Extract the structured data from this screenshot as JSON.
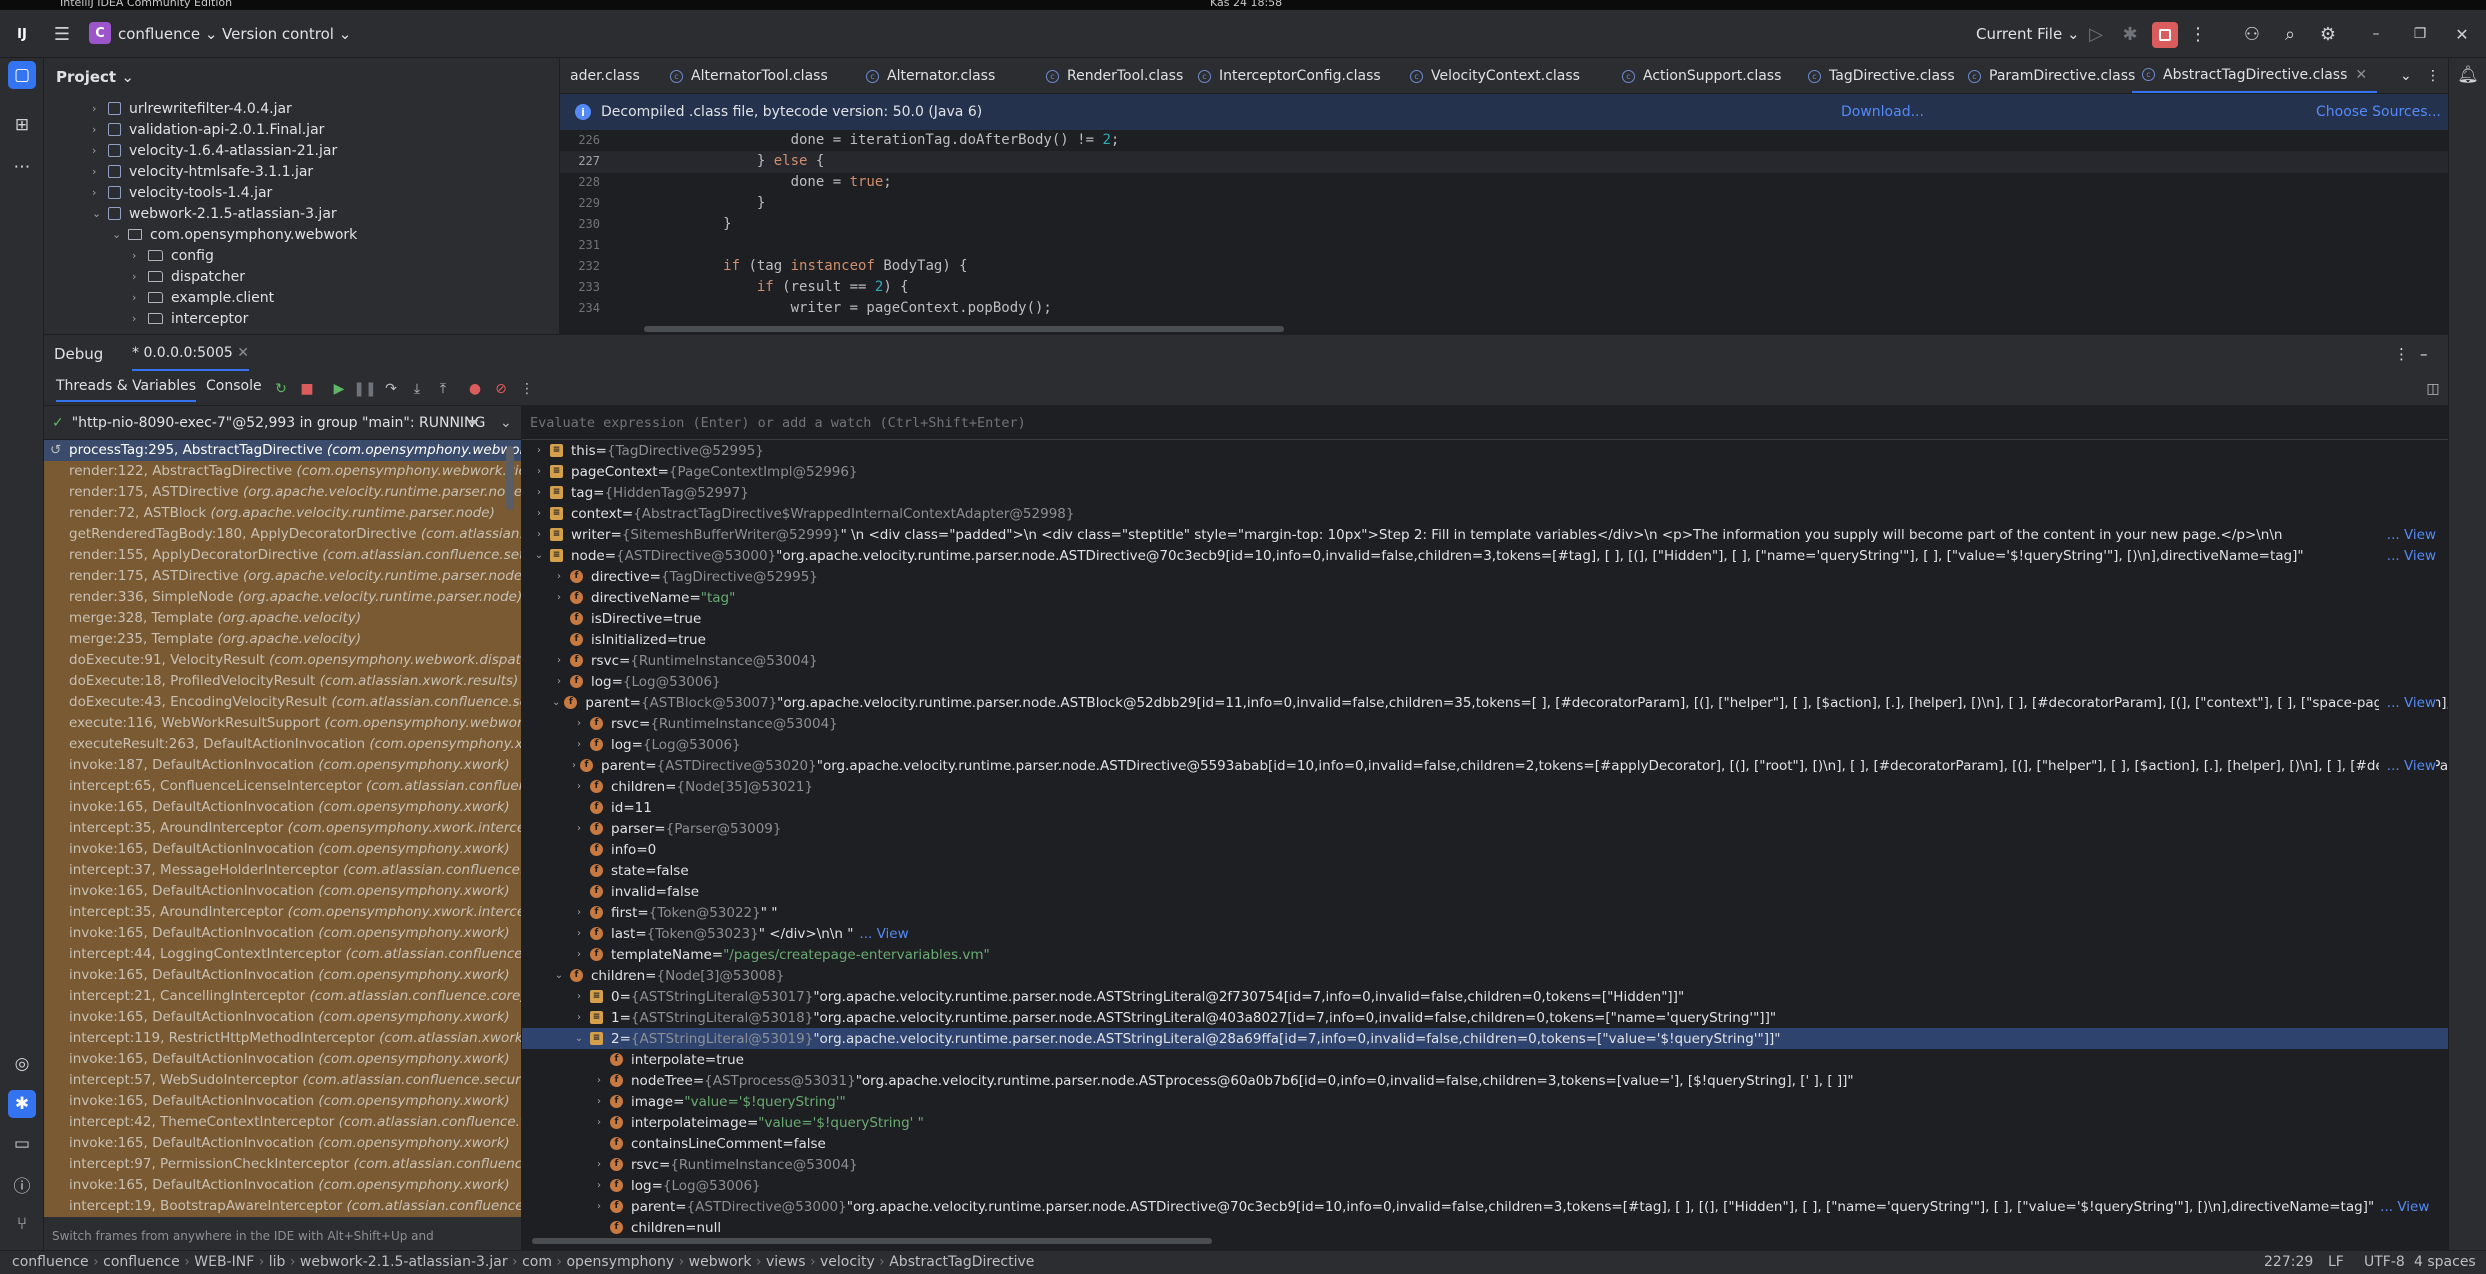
{
  "os": {
    "window_title": "IntelliJ IDEA Community Edition",
    "clock": "Kas 24 18:58"
  },
  "topbar": {
    "project_badge": "C",
    "project_name": "confluence",
    "vcs_label": "Version control",
    "run_config": "Current File"
  },
  "project": {
    "header": "Project",
    "items": [
      {
        "label": "urlrewritefilter-4.0.4.jar",
        "type": "jar",
        "indent": 0
      },
      {
        "label": "validation-api-2.0.1.Final.jar",
        "type": "jar",
        "indent": 0
      },
      {
        "label": "velocity-1.6.4-atlassian-21.jar",
        "type": "jar",
        "indent": 0
      },
      {
        "label": "velocity-htmlsafe-3.1.1.jar",
        "type": "jar",
        "indent": 0
      },
      {
        "label": "velocity-tools-1.4.jar",
        "type": "jar",
        "indent": 0
      },
      {
        "label": "webwork-2.1.5-atlassian-3.jar",
        "type": "jar",
        "indent": 0,
        "expanded": true
      },
      {
        "label": "com.opensymphony.webwork",
        "type": "package",
        "indent": 1,
        "expanded": true
      },
      {
        "label": "config",
        "type": "folder",
        "indent": 2
      },
      {
        "label": "dispatcher",
        "type": "folder",
        "indent": 2
      },
      {
        "label": "example.client",
        "type": "folder",
        "indent": 2
      },
      {
        "label": "interceptor",
        "type": "folder",
        "indent": 2
      }
    ]
  },
  "editor": {
    "tabs": [
      "ader.class",
      "AlternatorTool.class",
      "Alternator.class",
      "RenderTool.class",
      "InterceptorConfig.class",
      "VelocityContext.class",
      "ActionSupport.class",
      "TagDirective.class",
      "ParamDirective.class",
      "AbstractTagDirective.class"
    ],
    "active_tab": "AbstractTagDirective.class",
    "banner": {
      "message": "Decompiled .class file, bytecode version: 50.0 (Java 6)",
      "download": "Download...",
      "choose_sources": "Choose Sources..."
    },
    "lines": [
      {
        "n": "226",
        "code": "                    done = iterationTag.doAfterBody() != 2;"
      },
      {
        "n": "227",
        "code": "                } else {"
      },
      {
        "n": "228",
        "code": "                    done = true;"
      },
      {
        "n": "229",
        "code": "                }"
      },
      {
        "n": "230",
        "code": "            }"
      },
      {
        "n": "231",
        "code": ""
      },
      {
        "n": "232",
        "code": "            if (tag instanceof BodyTag) {"
      },
      {
        "n": "233",
        "code": "                if (result == 2) {"
      },
      {
        "n": "234",
        "code": "                    writer = pageContext.popBody();"
      }
    ],
    "current_line": "227"
  },
  "debug": {
    "title": "Debug",
    "session": "0.0.0.0:5005",
    "tabs": [
      "Threads & Variables",
      "Console"
    ],
    "thread": "\"http-nio-8090-exec-7\"@52,993 in group \"main\": RUNNING",
    "frames": [
      {
        "loc": "processTag:295, AbstractTagDirective",
        "cls": "(com.opensymphony.webwork.views.velocity)"
      },
      {
        "loc": "render:122, AbstractTagDirective",
        "cls": "(com.opensymphony.webwork.views.velocity)"
      },
      {
        "loc": "render:175, ASTDirective",
        "cls": "(org.apache.velocity.runtime.parser.node)"
      },
      {
        "loc": "render:72, ASTBlock",
        "cls": "(org.apache.velocity.runtime.parser.node)"
      },
      {
        "loc": "getRenderedTagBody:180, ApplyDecoratorDirective",
        "cls": "(com.atlassian.confluence.setup.velocity)"
      },
      {
        "loc": "render:155, ApplyDecoratorDirective",
        "cls": "(com.atlassian.confluence.setup.velocity)"
      },
      {
        "loc": "render:175, ASTDirective",
        "cls": "(org.apache.velocity.runtime.parser.node)"
      },
      {
        "loc": "render:336, SimpleNode",
        "cls": "(org.apache.velocity.runtime.parser.node)"
      },
      {
        "loc": "merge:328, Template",
        "cls": "(org.apache.velocity)"
      },
      {
        "loc": "merge:235, Template",
        "cls": "(org.apache.velocity)"
      },
      {
        "loc": "doExecute:91, VelocityResult",
        "cls": "(com.opensymphony.webwork.dispatcher)"
      },
      {
        "loc": "doExecute:18, ProfiledVelocityResult",
        "cls": "(com.atlassian.xwork.results)"
      },
      {
        "loc": "doExecute:43, EncodingVelocityResult",
        "cls": "(com.atlassian.confluence.setup.webwork)"
      },
      {
        "loc": "execute:116, WebWorkResultSupport",
        "cls": "(com.opensymphony.webwork.dispatcher)"
      },
      {
        "loc": "executeResult:263, DefaultActionInvocation",
        "cls": "(com.opensymphony.xwork)"
      },
      {
        "loc": "invoke:187, DefaultActionInvocation",
        "cls": "(com.opensymphony.xwork)"
      },
      {
        "loc": "intercept:65, ConfluenceLicenseInterceptor",
        "cls": "(com.atlassian.confluence.core)"
      },
      {
        "loc": "invoke:165, DefaultActionInvocation",
        "cls": "(com.opensymphony.xwork)"
      },
      {
        "loc": "intercept:35, AroundInterceptor",
        "cls": "(com.opensymphony.xwork.interceptor)"
      },
      {
        "loc": "invoke:165, DefaultActionInvocation",
        "cls": "(com.opensymphony.xwork)"
      },
      {
        "loc": "intercept:37, MessageHolderInterceptor",
        "cls": "(com.atlassian.confluence.validation)"
      },
      {
        "loc": "invoke:165, DefaultActionInvocation",
        "cls": "(com.opensymphony.xwork)"
      },
      {
        "loc": "intercept:35, AroundInterceptor",
        "cls": "(com.opensymphony.xwork.interceptor)"
      },
      {
        "loc": "invoke:165, DefaultActionInvocation",
        "cls": "(com.opensymphony.xwork)"
      },
      {
        "loc": "intercept:44, LoggingContextInterceptor",
        "cls": "(com.atlassian.confluence.util)"
      },
      {
        "loc": "invoke:165, DefaultActionInvocation",
        "cls": "(com.opensymphony.xwork)"
      },
      {
        "loc": "intercept:21, CancellingInterceptor",
        "cls": "(com.atlassian.confluence.core)"
      },
      {
        "loc": "invoke:165, DefaultActionInvocation",
        "cls": "(com.opensymphony.xwork)"
      },
      {
        "loc": "intercept:119, RestrictHttpMethodInterceptor",
        "cls": "(com.atlassian.xwork.interceptors)"
      },
      {
        "loc": "invoke:165, DefaultActionInvocation",
        "cls": "(com.opensymphony.xwork)"
      },
      {
        "loc": "intercept:57, WebSudoInterceptor",
        "cls": "(com.atlassian.confluence.security.websudo)"
      },
      {
        "loc": "invoke:165, DefaultActionInvocation",
        "cls": "(com.opensymphony.xwork)"
      },
      {
        "loc": "intercept:42, ThemeContextInterceptor",
        "cls": "(com.atlassian.confluence.themes)"
      },
      {
        "loc": "invoke:165, DefaultActionInvocation",
        "cls": "(com.opensymphony.xwork)"
      },
      {
        "loc": "intercept:97, PermissionCheckInterceptor",
        "cls": "(com.atlassian.confluence.security)"
      },
      {
        "loc": "invoke:165, DefaultActionInvocation",
        "cls": "(com.opensymphony.xwork)"
      },
      {
        "loc": "intercept:19, BootstrapAwareInterceptor",
        "cls": "(com.atlassian.confluence.setup)"
      }
    ],
    "frames_hint": "Switch frames from anywhere in the IDE with Alt+Shift+Up and Alt+Shift+Down",
    "eval_placeholder": "Evaluate expression (Enter) or add a watch (Ctrl+Shift+Enter)",
    "vars": [
      {
        "lvl": 0,
        "ch": true,
        "b": "sq",
        "name": "this",
        "type": "{TagDirective@52995}",
        "val": ""
      },
      {
        "lvl": 0,
        "ch": true,
        "b": "sq",
        "name": "pageContext",
        "type": "{PageContextImpl@52996}",
        "val": ""
      },
      {
        "lvl": 0,
        "ch": true,
        "b": "sq",
        "name": "tag",
        "type": "{HiddenTag@52997}",
        "val": ""
      },
      {
        "lvl": 0,
        "ch": true,
        "b": "sq",
        "name": "context",
        "type": "{AbstractTagDirective$WrappedInternalContextAdapter@52998}",
        "val": ""
      },
      {
        "lvl": 0,
        "ch": true,
        "b": "sq",
        "name": "writer",
        "type": "{SitemeshBufferWriter@52999}",
        "val": "\"  \\n          <div class=\"padded\">\\n            <div class=\"steptitle\" style=\"margin-top: 10px\">Step 2: Fill in template variables</div>\\n            <p>The information you supply will become part of the content in your new page.</p>\\n\\n",
        "view": "... View"
      },
      {
        "lvl": 0,
        "ch": true,
        "exp": true,
        "b": "sq",
        "name": "node",
        "type": "{ASTDirective@53000}",
        "val": "\"org.apache.velocity.runtime.parser.node.ASTDirective@70c3ecb9[id=10,info=0,invalid=false,children=3,tokens=[#tag], [ ], [(], [\"Hidden\"], [ ], [\"name='queryString'\"], [ ], [\"value='$!queryString'\"], [)\\n],directiveName=tag]\"",
        "view": "... View"
      },
      {
        "lvl": 1,
        "ch": true,
        "b": "f",
        "name": "directive",
        "type": "{TagDirective@52995}",
        "val": ""
      },
      {
        "lvl": 1,
        "ch": true,
        "b": "f",
        "name": "directiveName",
        "type": "",
        "val": "\"tag\"",
        "str": true
      },
      {
        "lvl": 1,
        "ch": false,
        "b": "f",
        "name": "isDirective",
        "type": "",
        "val": "true"
      },
      {
        "lvl": 1,
        "ch": false,
        "b": "f",
        "name": "isInitialized",
        "type": "",
        "val": "true"
      },
      {
        "lvl": 1,
        "ch": true,
        "b": "f",
        "name": "rsvc",
        "type": "{RuntimeInstance@53004}",
        "val": ""
      },
      {
        "lvl": 1,
        "ch": true,
        "b": "f",
        "name": "log",
        "type": "{Log@53006}",
        "val": ""
      },
      {
        "lvl": 1,
        "ch": true,
        "exp": true,
        "b": "f",
        "name": "parent",
        "type": "{ASTBlock@53007}",
        "val": "\"org.apache.velocity.runtime.parser.node.ASTBlock@52dbb29[id=11,info=0,invalid=false,children=35,tokens=[        ], [#decoratorParam], [(], [\"helper\"], [ ], [$action], [.], [helper], [)\\n], [        ], [#decoratorParam], [(], [\"context\"], [ ], [\"space-pages\"], [)\\n], [",
        "view": "... View"
      },
      {
        "lvl": 2,
        "ch": true,
        "b": "f",
        "name": "rsvc",
        "type": "{RuntimeInstance@53004}",
        "val": ""
      },
      {
        "lvl": 2,
        "ch": true,
        "b": "f",
        "name": "log",
        "type": "{Log@53006}",
        "val": ""
      },
      {
        "lvl": 2,
        "ch": true,
        "b": "f",
        "name": "parent",
        "type": "{ASTDirective@53020}",
        "val": "\"org.apache.velocity.runtime.parser.node.ASTDirective@5593abab[id=10,info=0,invalid=false,children=2,tokens=[#applyDecorator], [(], [\"root\"], [)\\n], [        ], [#decoratorParam], [(], [\"helper\"], [ ], [$action], [.], [helper], [)\\n], [        ], [#decoratorParam]",
        "view": "... View"
      },
      {
        "lvl": 2,
        "ch": true,
        "b": "f",
        "name": "children",
        "type": "{Node[35]@53021}",
        "val": ""
      },
      {
        "lvl": 2,
        "ch": false,
        "b": "f",
        "name": "id",
        "type": "",
        "val": "11"
      },
      {
        "lvl": 2,
        "ch": true,
        "b": "f",
        "name": "parser",
        "type": "{Parser@53009}",
        "val": ""
      },
      {
        "lvl": 2,
        "ch": false,
        "b": "f",
        "name": "info",
        "type": "",
        "val": "0"
      },
      {
        "lvl": 2,
        "ch": false,
        "b": "f",
        "name": "state",
        "type": "",
        "val": "false"
      },
      {
        "lvl": 2,
        "ch": false,
        "b": "f",
        "name": "invalid",
        "type": "",
        "val": "false"
      },
      {
        "lvl": 2,
        "ch": true,
        "b": "f",
        "name": "first",
        "type": "{Token@53022}",
        "val": "\"        \""
      },
      {
        "lvl": 2,
        "ch": true,
        "b": "f",
        "name": "last",
        "type": "{Token@53023}",
        "val": "\"        </div>\\n\\n        \"",
        "view": "... View",
        "inline_view": true
      },
      {
        "lvl": 2,
        "ch": true,
        "b": "f",
        "name": "templateName",
        "type": "",
        "val": "\"/pages/createpage-entervariables.vm\"",
        "str": true
      },
      {
        "lvl": 1,
        "ch": true,
        "exp": true,
        "b": "f",
        "name": "children",
        "type": "{Node[3]@53008}",
        "val": ""
      },
      {
        "lvl": 2,
        "ch": true,
        "b": "sq",
        "name": "0",
        "type": "{ASTStringLiteral@53017}",
        "val": "\"org.apache.velocity.runtime.parser.node.ASTStringLiteral@2f730754[id=7,info=0,invalid=false,children=0,tokens=[\"Hidden\"]]\""
      },
      {
        "lvl": 2,
        "ch": true,
        "b": "sq",
        "name": "1",
        "type": "{ASTStringLiteral@53018}",
        "val": "\"org.apache.velocity.runtime.parser.node.ASTStringLiteral@403a8027[id=7,info=0,invalid=false,children=0,tokens=[\"name='queryString'\"]]\""
      },
      {
        "lvl": 2,
        "ch": true,
        "exp": true,
        "sel": true,
        "b": "sq",
        "name": "2",
        "type": "{ASTStringLiteral@53019}",
        "val": "\"org.apache.velocity.runtime.parser.node.ASTStringLiteral@28a69ffa[id=7,info=0,invalid=false,children=0,tokens=[\"value='$!queryString'\"]]\""
      },
      {
        "lvl": 3,
        "ch": false,
        "b": "f",
        "name": "interpolate",
        "type": "",
        "val": "true"
      },
      {
        "lvl": 3,
        "ch": true,
        "b": "f",
        "name": "nodeTree",
        "type": "{ASTprocess@53031}",
        "val": "\"org.apache.velocity.runtime.parser.node.ASTprocess@60a0b7b6[id=0,info=0,invalid=false,children=3,tokens=[value='], [$!queryString], [' ], [ ]]\""
      },
      {
        "lvl": 3,
        "ch": true,
        "b": "f",
        "name": "image",
        "type": "",
        "val": "\"value='$!queryString'\"",
        "str": true
      },
      {
        "lvl": 3,
        "ch": true,
        "b": "f",
        "name": "interpolateimage",
        "type": "",
        "val": "\"value='$!queryString' \"",
        "str": true
      },
      {
        "lvl": 3,
        "ch": false,
        "b": "f",
        "name": "containsLineComment",
        "type": "",
        "val": "false"
      },
      {
        "lvl": 3,
        "ch": true,
        "b": "f",
        "name": "rsvc",
        "type": "{RuntimeInstance@53004}",
        "val": ""
      },
      {
        "lvl": 3,
        "ch": true,
        "b": "f",
        "name": "log",
        "type": "{Log@53006}",
        "val": ""
      },
      {
        "lvl": 3,
        "ch": true,
        "b": "f",
        "name": "parent",
        "type": "{ASTDirective@53000}",
        "val": "\"org.apache.velocity.runtime.parser.node.ASTDirective@70c3ecb9[id=10,info=0,invalid=false,children=3,tokens=[#tag], [ ], [(], [\"Hidden\"], [ ], [\"name='queryString'\"], [ ], [\"value='$!queryString'\"], [)\\n],directiveName=tag]\"",
        "view": "... View",
        "inline_view": true
      },
      {
        "lvl": 3,
        "ch": false,
        "b": "f",
        "name": "children",
        "type": "",
        "val": "null"
      }
    ]
  },
  "status": {
    "breadcrumb": [
      "confluence",
      "confluence",
      "WEB-INF",
      "lib",
      "webwork-2.1.5-atlassian-3.jar",
      "com",
      "opensymphony",
      "webwork",
      "views",
      "velocity",
      "AbstractTagDirective"
    ],
    "position": "227:29",
    "line_sep": "LF",
    "encoding": "UTF-8",
    "indent": "4 spaces"
  }
}
